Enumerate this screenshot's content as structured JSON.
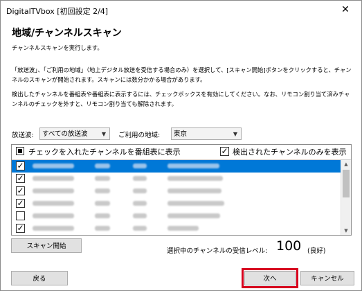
{
  "window": {
    "title": "DigitalTVbox [初回設定 2/4]",
    "close_symbol": "✕"
  },
  "page": {
    "title": "地域/チャンネルスキャン",
    "description_1": "チャンネルスキャンを実行します。",
    "description_2": "「放送波」、「ご利用の地域」（地上デジタル放送を受信する場合のみ）を選択して、[スキャン開始]ボタンをクリックすると、チャンネルのスキャンが開始されます。スキャンには数分かかる場合があります。",
    "description_3": "検出したチャンネルを番組表や番組表に表示するには、チェックボックスを有効にしてください。なお、リモコン割り当て済みチャンネルのチェックを外すと、リモコン割り当ても解除されます。"
  },
  "filters": {
    "broadcast_label": "放送波:",
    "broadcast_value": "すべての放送波",
    "region_label": "ご利用の地域:",
    "region_value": "東京"
  },
  "channel_list": {
    "show_in_guide_label": "チェックを入れたチャンネルを番組表に表示",
    "only_detected_label": "検出されたチャンネルのみを表示",
    "check_mark": "✓",
    "rows": [
      {
        "checked": true,
        "selected": true
      },
      {
        "checked": true,
        "selected": false
      },
      {
        "checked": true,
        "selected": false
      },
      {
        "checked": true,
        "selected": false
      },
      {
        "checked": false,
        "selected": false
      },
      {
        "checked": true,
        "selected": false
      }
    ]
  },
  "scan": {
    "button_label": "スキャン開始",
    "level_label": "選択中のチャンネルの受信レベル:",
    "level_value": "100",
    "level_status": "(良好)"
  },
  "footer": {
    "back_label": "戻る",
    "next_label": "次へ",
    "cancel_label": "キャンセル"
  },
  "colors": {
    "selection": "#0078d7",
    "highlight": "#d6001c"
  }
}
